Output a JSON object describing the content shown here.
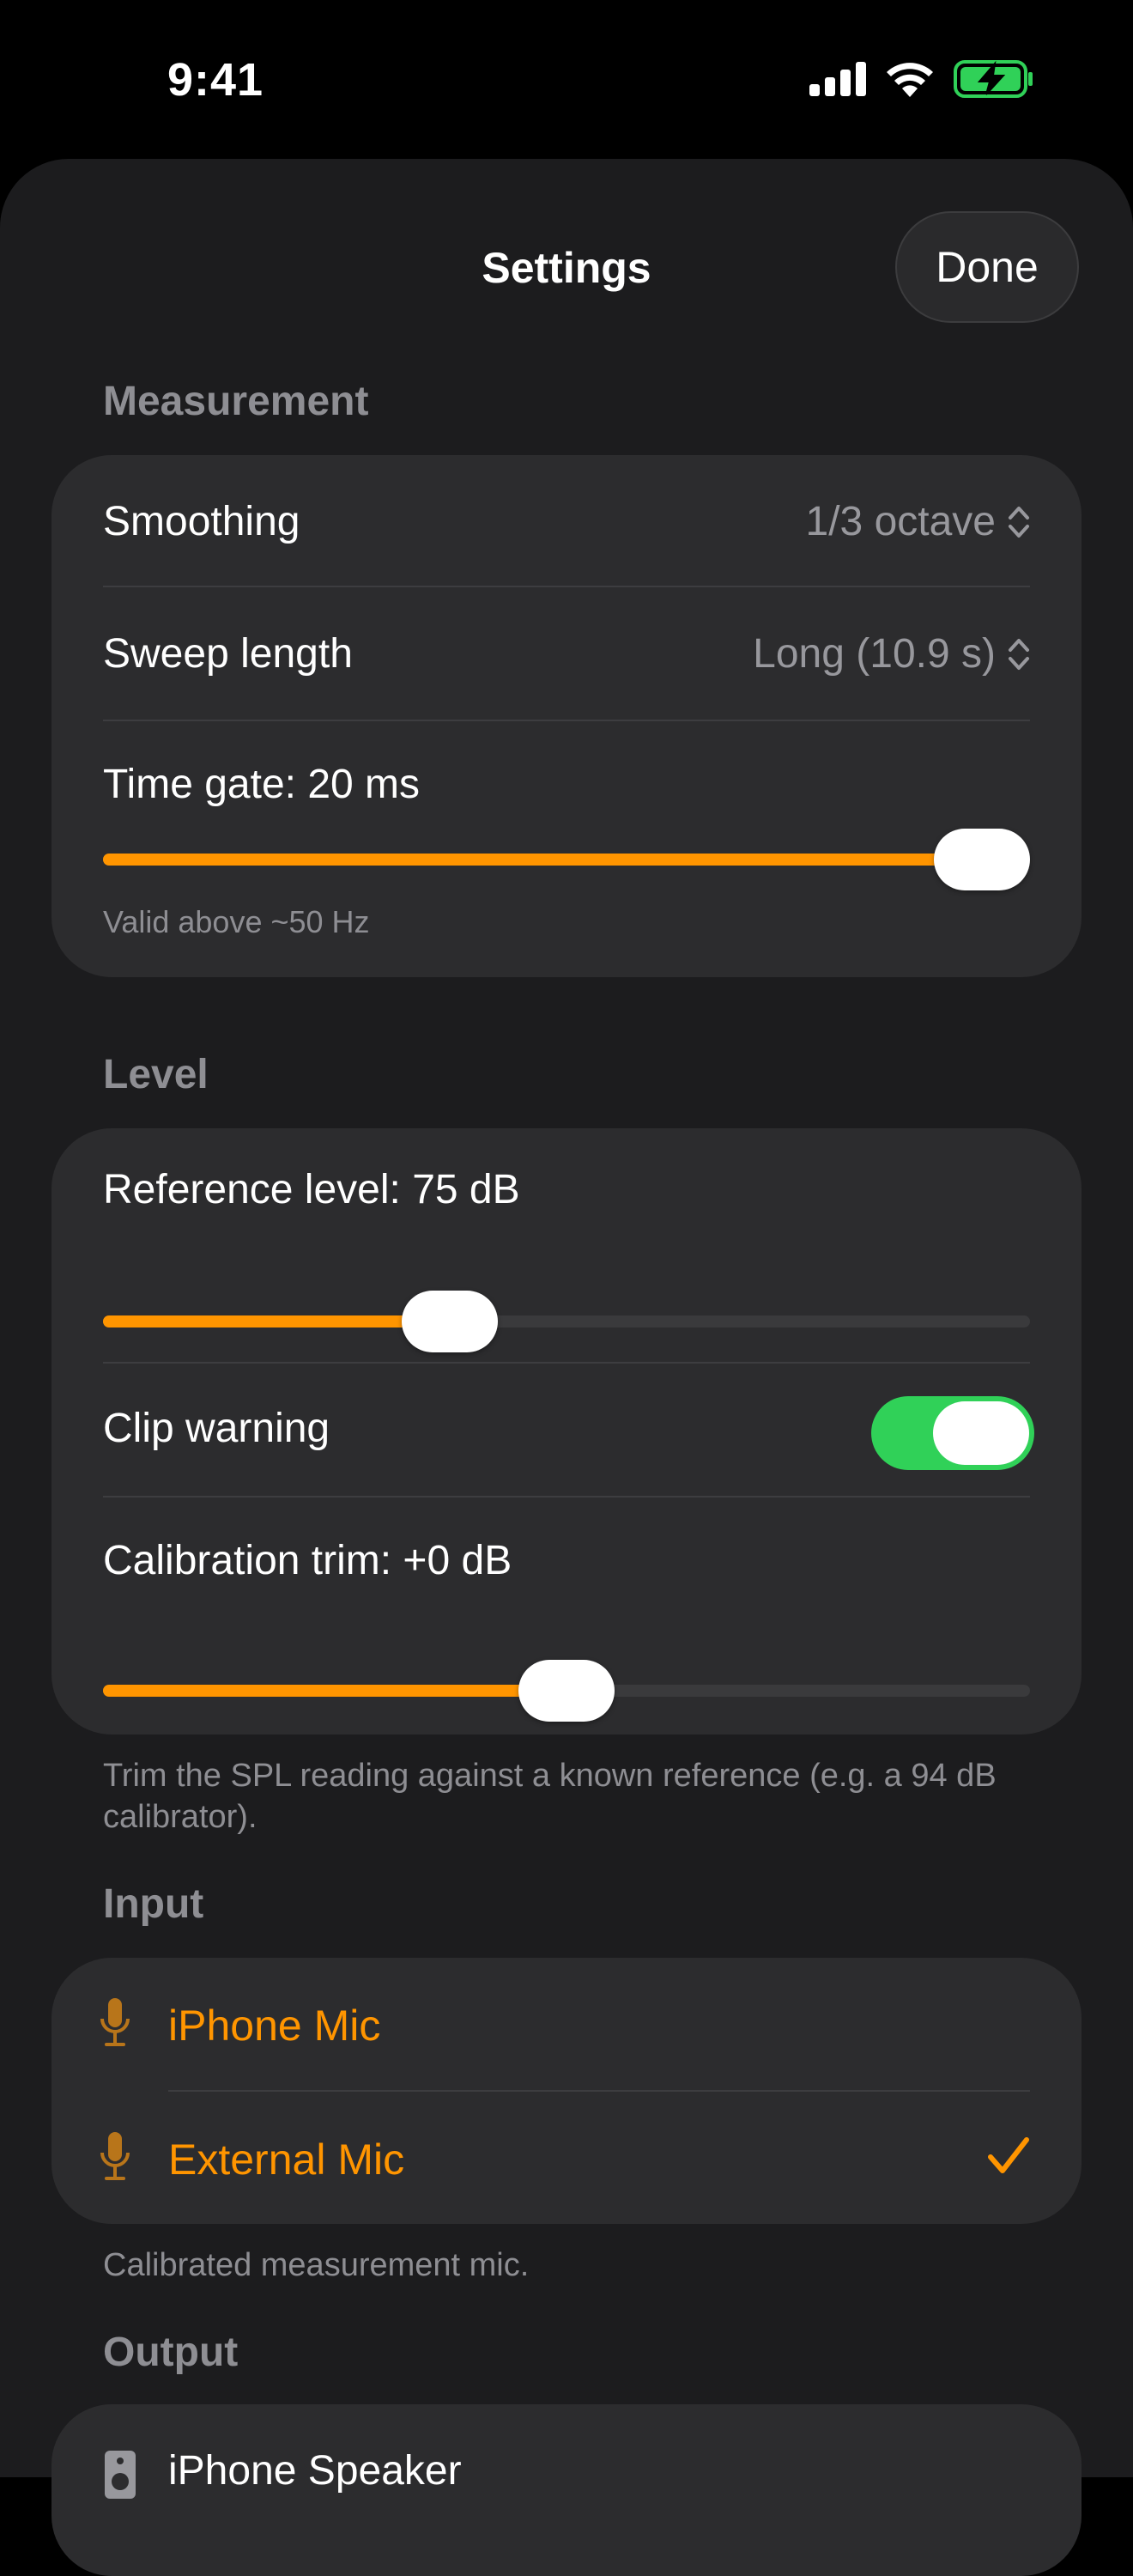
{
  "status_bar": {
    "time": "9:41",
    "icons": [
      "cellular-signal-icon",
      "wifi-icon",
      "battery-charging-icon"
    ]
  },
  "nav": {
    "title": "Settings",
    "done_label": "Done"
  },
  "measurement": {
    "header": "Measurement",
    "smoothing": {
      "label": "Smoothing",
      "value": "1/3 octave"
    },
    "sweep_length": {
      "label": "Sweep length",
      "value": "Long (10.9 s)"
    },
    "time_gate": {
      "label": "Time gate: 20 ms",
      "fraction": 1.0,
      "note": "Valid above ~50 Hz"
    }
  },
  "level": {
    "header": "Level",
    "reference_level": {
      "label": "Reference level: 75 dB",
      "fraction": 0.36
    },
    "clip_warning": {
      "label": "Clip warning",
      "on": true
    },
    "calibration_trim": {
      "label": "Calibration trim: +0 dB",
      "fraction": 0.5
    },
    "footer": "Trim the SPL reading against a known reference (e.g. a 94 dB calibrator)."
  },
  "input": {
    "header": "Input",
    "options": [
      {
        "label": "iPhone Mic",
        "selected": false
      },
      {
        "label": "External Mic",
        "selected": true
      }
    ],
    "footer": "Calibrated measurement mic."
  },
  "output": {
    "header": "Output",
    "first_option": "iPhone Speaker"
  },
  "colors": {
    "accent": "#ff9500",
    "toggle_on": "#30d158",
    "background": "#1c1c1e",
    "card": "#2c2c2e",
    "secondary_text": "#8e8e93"
  }
}
